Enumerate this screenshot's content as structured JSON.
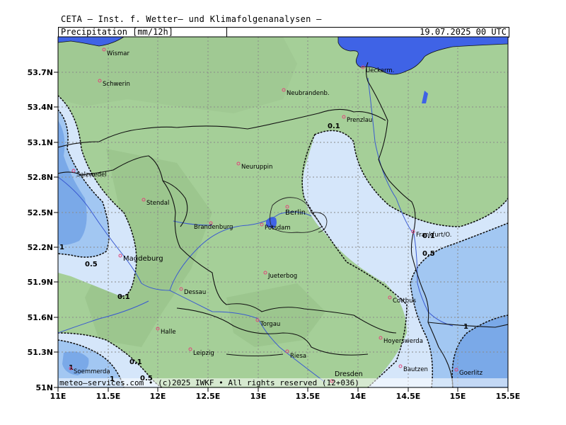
{
  "header": {
    "institute": "CETA — Inst. f. Wetter— und Klimafolgenanalysen —",
    "parameter": "Precipitation",
    "unit": "mm/12h",
    "valid_time": "19.07.2025 00 UTC"
  },
  "footer": {
    "copyright": "meteo—services.com • (c)2025 IWKF • All rights reserved (12+036)"
  },
  "axes": {
    "lon_labels": [
      "11E",
      "11.5E",
      "12E",
      "12.5E",
      "13E",
      "13.5E",
      "14E",
      "14.5E",
      "15E",
      "15.5E"
    ],
    "lat_labels": [
      "53.7N",
      "53.4N",
      "53.1N",
      "52.8N",
      "52.5N",
      "52.2N",
      "51.9N",
      "51.6N",
      "51.3N",
      "51N"
    ]
  },
  "legend_colors": {
    "water": "#3f63e6",
    "below_0_1": "#a5cf98",
    "from_0_1_to_0_5": "#d5e6fa",
    "from_0_5_to_1": "#a2c7f2",
    "above_1": "#7aa9e8"
  },
  "contour_labels": [
    {
      "text": "0.1"
    },
    {
      "text": "0.1"
    },
    {
      "text": "0.5"
    },
    {
      "text": "0.1"
    },
    {
      "text": "0.5"
    },
    {
      "text": "0.1"
    },
    {
      "text": "0.5"
    },
    {
      "text": "1"
    },
    {
      "text": "1"
    },
    {
      "text": "1"
    },
    {
      "text": "1"
    }
  ],
  "cities": [
    {
      "name": "Wismar"
    },
    {
      "name": "Schwerin"
    },
    {
      "name": "Ueckerm."
    },
    {
      "name": "Neubrandenb."
    },
    {
      "name": "Prenzlau"
    },
    {
      "name": "Salzwedel"
    },
    {
      "name": "Neuruppin"
    },
    {
      "name": "Stendal"
    },
    {
      "name": "Berlin"
    },
    {
      "name": "Brandenburg"
    },
    {
      "name": "Potsdam"
    },
    {
      "name": "Frankfurt/O."
    },
    {
      "name": "Magdeburg"
    },
    {
      "name": "Jueterbog"
    },
    {
      "name": "Dessau"
    },
    {
      "name": "Cottbus"
    },
    {
      "name": "Torgau"
    },
    {
      "name": "Halle"
    },
    {
      "name": "Hoyerswerda"
    },
    {
      "name": "Leipzig"
    },
    {
      "name": "Riesa"
    },
    {
      "name": "Soemmerda"
    },
    {
      "name": "Dresden"
    },
    {
      "name": "Bautzen"
    },
    {
      "name": "Goerlitz"
    }
  ]
}
